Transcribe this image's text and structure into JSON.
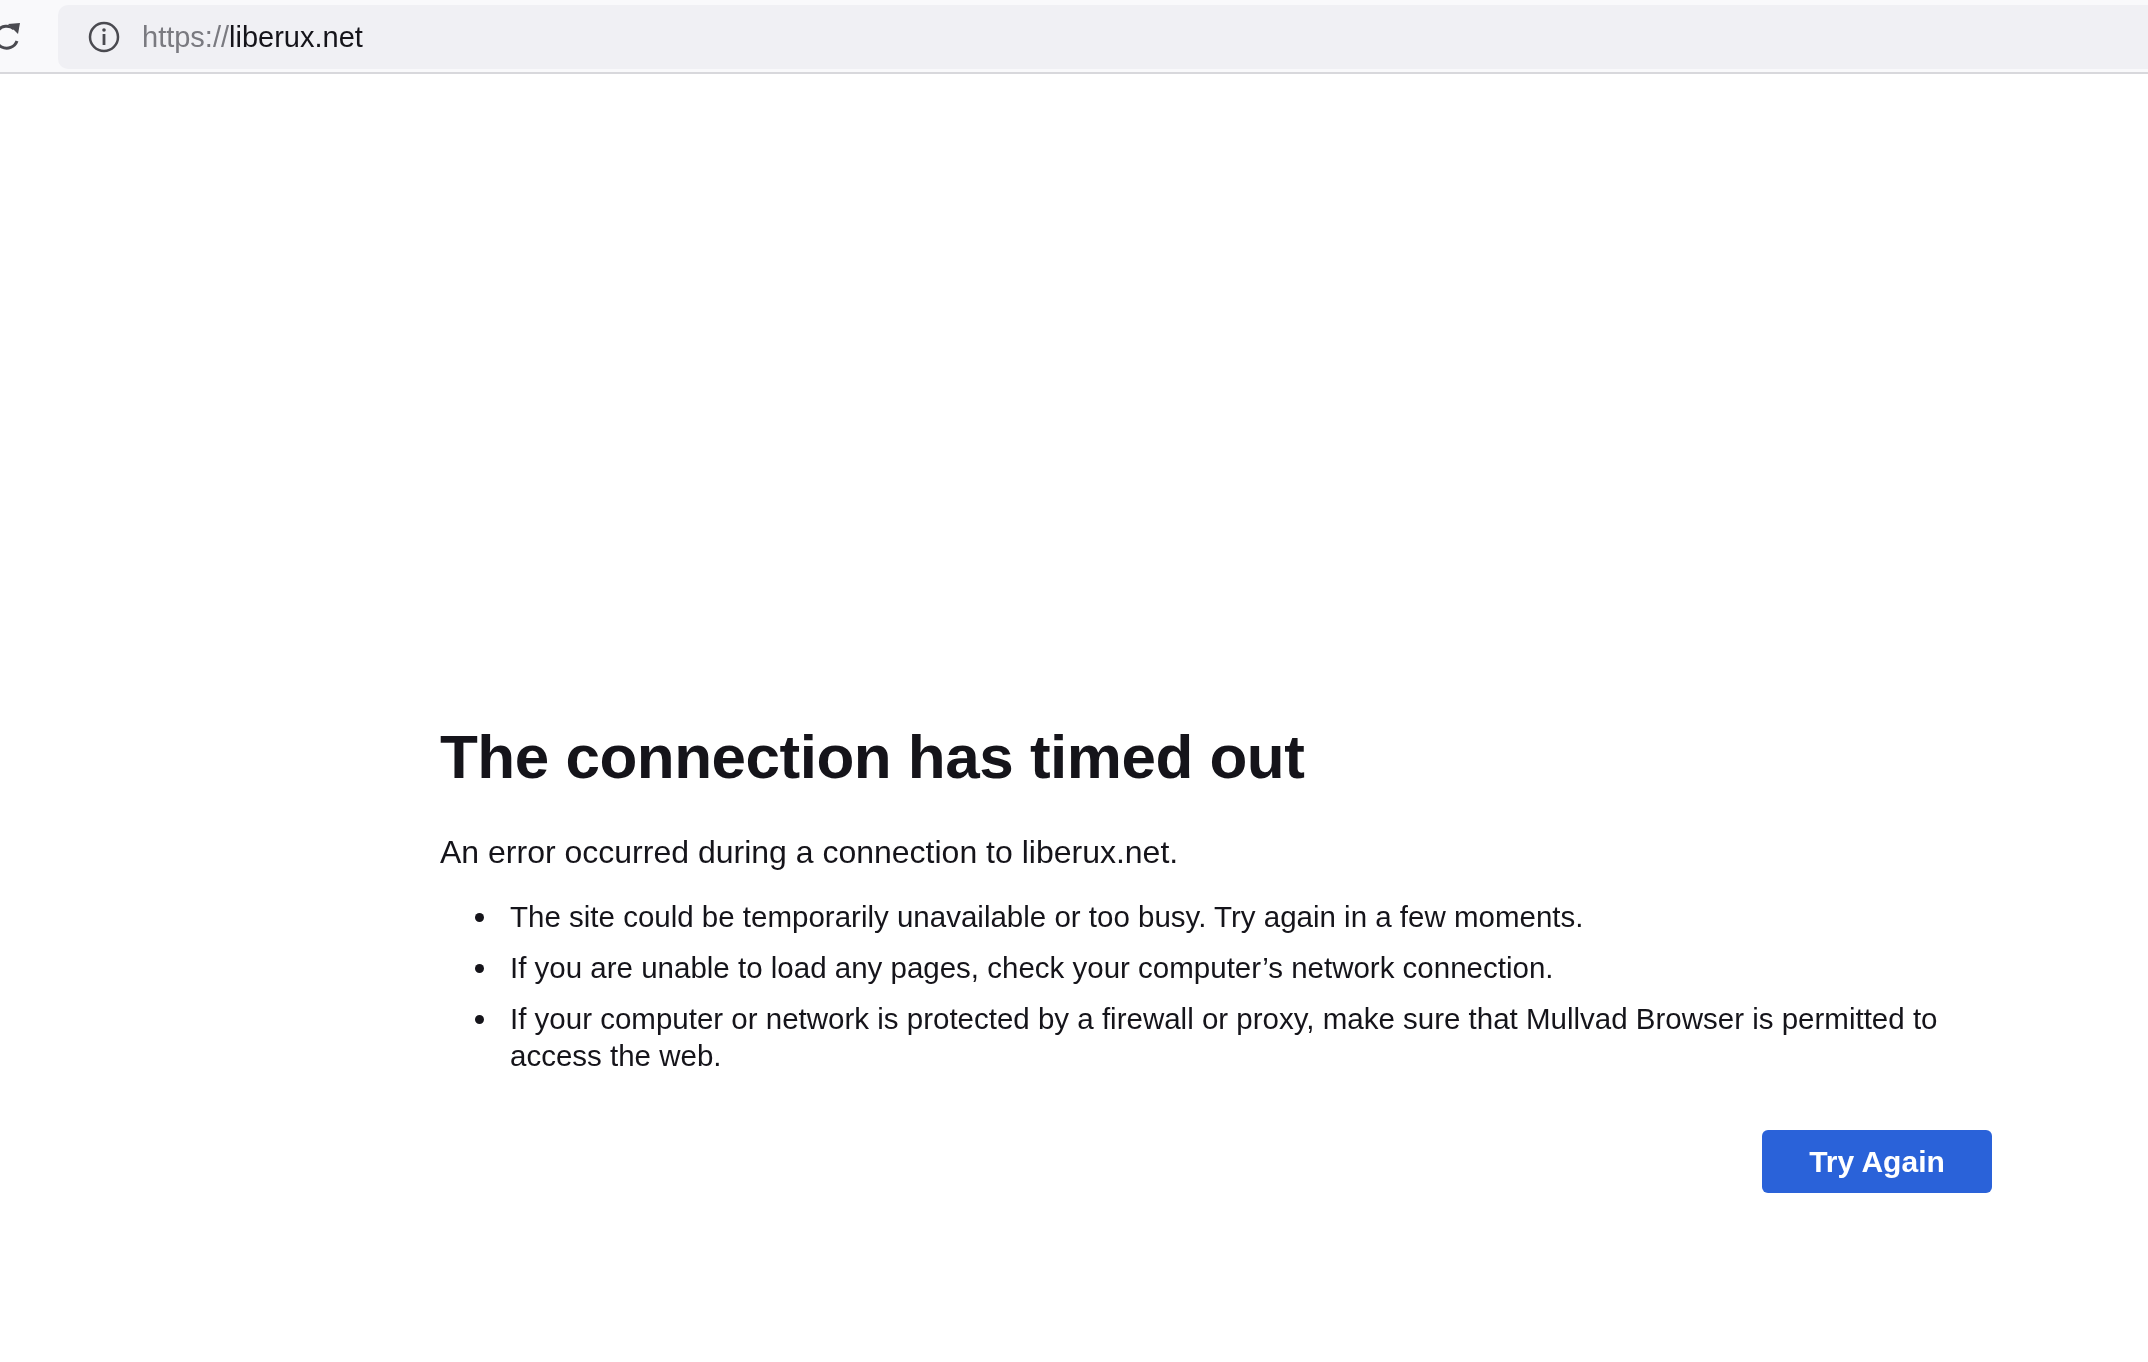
{
  "toolbar": {
    "url_scheme": "https://",
    "url_host": "liberux.net"
  },
  "error": {
    "title": "The connection has timed out",
    "description": "An error occurred during a connection to liberux.net.",
    "bullets": [
      "The site could be temporarily unavailable or too busy. Try again in a few moments.",
      "If you are unable to load any pages, check your computer’s network connection.",
      "If your computer or network is protected by a firewall or proxy, make sure that Mullvad Browser is permitted to access the web."
    ],
    "button": "Try Again"
  }
}
